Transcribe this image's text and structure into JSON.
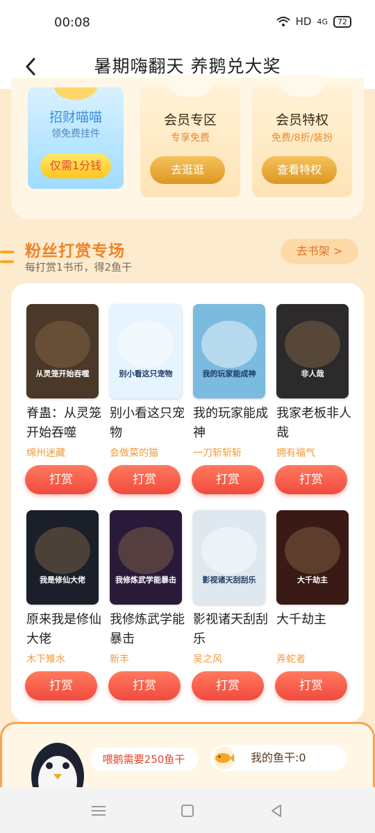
{
  "status": {
    "time": "00:08",
    "network": "HD",
    "signal": "4G",
    "battery": "72"
  },
  "header": {
    "title": "暑期嗨翻天 养鹅兑大奖"
  },
  "promo": {
    "cat": {
      "title": "招财喵喵",
      "sub": "领免费挂件",
      "button": "仅需1分钱"
    },
    "vip": {
      "title": "会员专区",
      "sub": "专享免费",
      "button": "去逛逛"
    },
    "privilege": {
      "title": "会员特权",
      "sub": "免费/8折/装扮",
      "button": "查看特权"
    }
  },
  "section": {
    "title": "粉丝打赏专场",
    "sub": "每打赏1书币，得2鱼干",
    "shelf_button": "去书架 >"
  },
  "reward_label": "打赏",
  "books": [
    {
      "title": "脊蛊：从灵笼开始吞噬",
      "author": "绵州迷藏",
      "cover_text": "从灵笼开始吞噬",
      "cover_color": "#4a3828"
    },
    {
      "title": "别小看这只宠物",
      "author": "会做菜的猫",
      "cover_text": "别小看这只宠物",
      "cover_color": "#e6f4ff"
    },
    {
      "title": "我的玩家能成神",
      "author": "一刀斩斩斩",
      "cover_text": "我的玩家能成神",
      "cover_color": "#7bbbe0"
    },
    {
      "title": "我家老板非人哉",
      "author": "拥有福气",
      "cover_text": "非人哉",
      "cover_color": "#2c2a2a"
    },
    {
      "title": "原来我是修仙大佬",
      "author": "木下雉水",
      "cover_text": "我是修仙大佬",
      "cover_color": "#1a1f2a"
    },
    {
      "title": "我修炼武学能暴击",
      "author": "新丰",
      "cover_text": "我修炼武学能暴击",
      "cover_color": "#2a1a3a"
    },
    {
      "title": "影视诸天刮刮乐",
      "author": "吴之风",
      "cover_text": "影视诸天刮刮乐",
      "cover_color": "#dfe8ef"
    },
    {
      "title": "大千劫主",
      "author": "弄蛇者",
      "cover_text": "大千劫主",
      "cover_color": "#3a1a14"
    }
  ],
  "feed": {
    "need": "喂鹅需要250鱼干",
    "fish": "我的鱼干:0"
  },
  "colors": {
    "accent": "#f08228",
    "reward": "#f04a3e",
    "panel": "#fff6e6",
    "background": "#fdebcf"
  }
}
